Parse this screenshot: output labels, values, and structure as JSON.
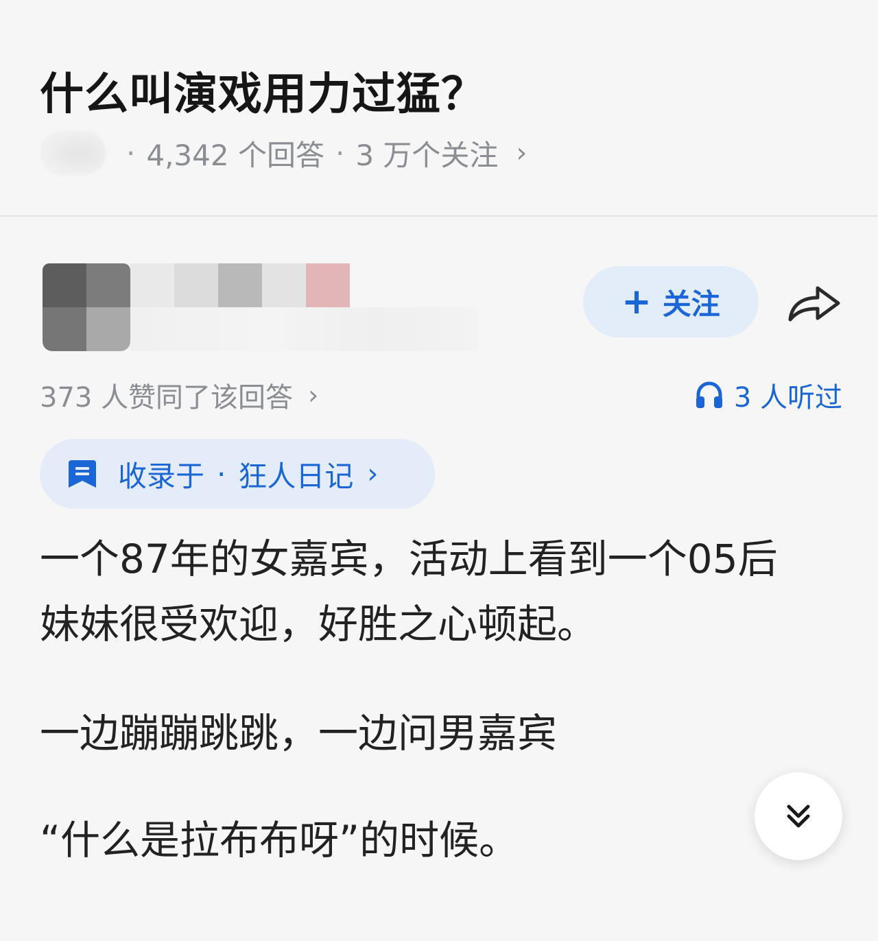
{
  "question": {
    "title": "什么叫演戏用力过猛？",
    "answer_count": "4,342 个回答",
    "follower_count": "3 万个关注",
    "separator": "·",
    "chevron": "›"
  },
  "answer": {
    "follow_label": "关注",
    "follow_plus": "+",
    "upvote_summary": "373 人赞同了该回答",
    "listen_count": "3 人听过",
    "collection": {
      "prefix": "收录于",
      "separator": "·",
      "name": "狂人日记"
    },
    "paragraphs": [
      [
        "一个87年的女嘉宾，活动上看到一个05后",
        "妹妹很受欢迎，好胜之心顿起。"
      ],
      [
        "一边蹦蹦跳跳，一边问男嘉宾"
      ],
      [
        "“什么是拉布布呀”的时候。"
      ]
    ]
  },
  "colors": {
    "accent_blue": "#1a66d6",
    "chip_bg": "#e3ecf8",
    "muted_text": "#8a8d93",
    "page_bg": "#f6f6f6"
  },
  "icons": {
    "share": "share-arrow-icon",
    "headphone": "headphone-icon",
    "collection": "bookmark-doc-icon",
    "collapse": "double-chevron-down-icon"
  }
}
